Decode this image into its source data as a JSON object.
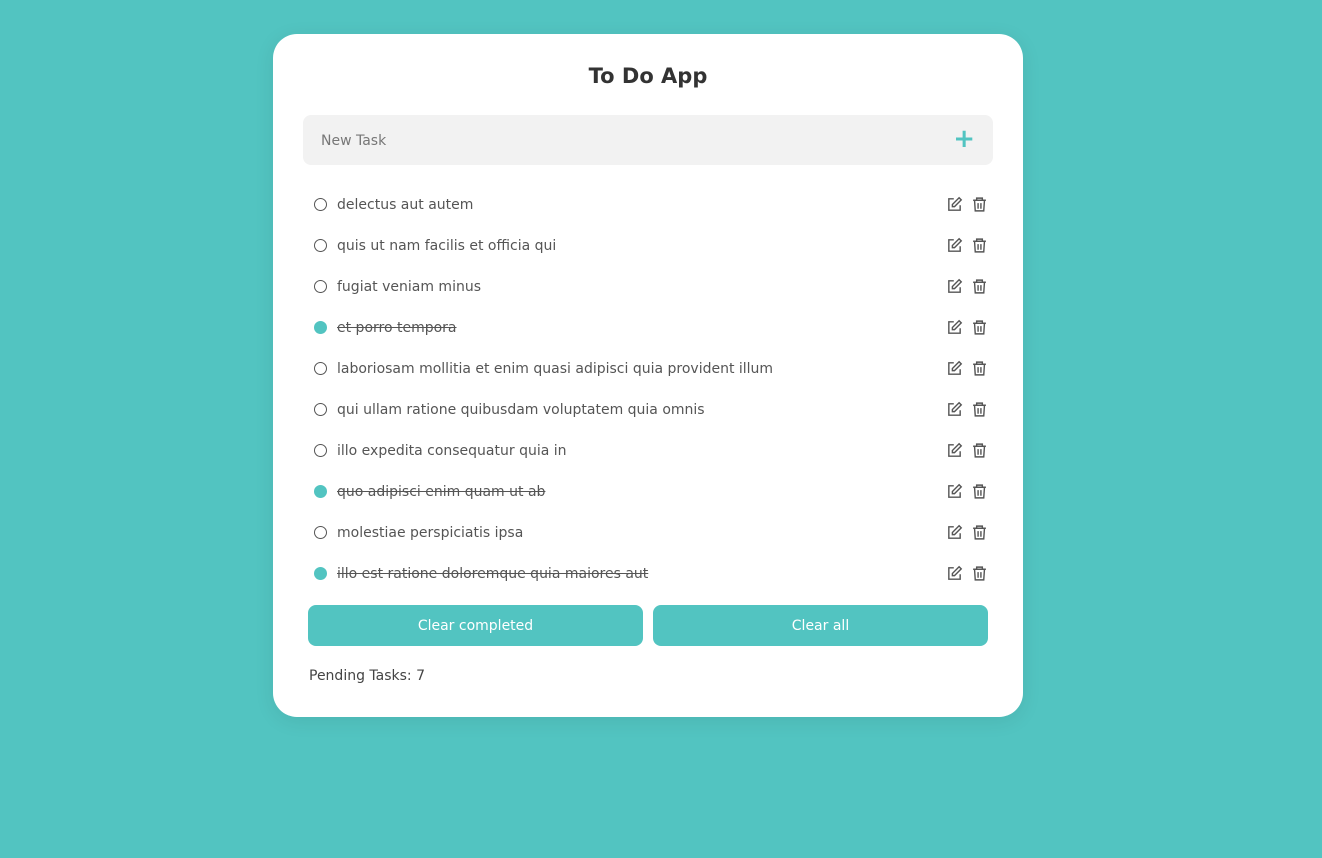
{
  "app": {
    "title": "To Do App"
  },
  "new_task": {
    "placeholder": "New Task",
    "value": "",
    "add_icon": "plus-icon"
  },
  "tasks": [
    {
      "text": "delectus aut autem",
      "completed": false
    },
    {
      "text": "quis ut nam facilis et officia qui",
      "completed": false
    },
    {
      "text": "fugiat veniam minus",
      "completed": false
    },
    {
      "text": "et porro tempora",
      "completed": true
    },
    {
      "text": "laboriosam mollitia et enim quasi adipisci quia provident illum",
      "completed": false
    },
    {
      "text": "qui ullam ratione quibusdam voluptatem quia omnis",
      "completed": false
    },
    {
      "text": "illo expedita consequatur quia in",
      "completed": false
    },
    {
      "text": "quo adipisci enim quam ut ab",
      "completed": true
    },
    {
      "text": "molestiae perspiciatis ipsa",
      "completed": false
    },
    {
      "text": "illo est ratione doloremque quia maiores aut",
      "completed": true
    }
  ],
  "actions": {
    "clear_completed": "Clear completed",
    "clear_all": "Clear all"
  },
  "footer": {
    "pending": "Pending Tasks: 7"
  },
  "colors": {
    "accent": "#52c4c1",
    "background": "#52c4c1"
  }
}
